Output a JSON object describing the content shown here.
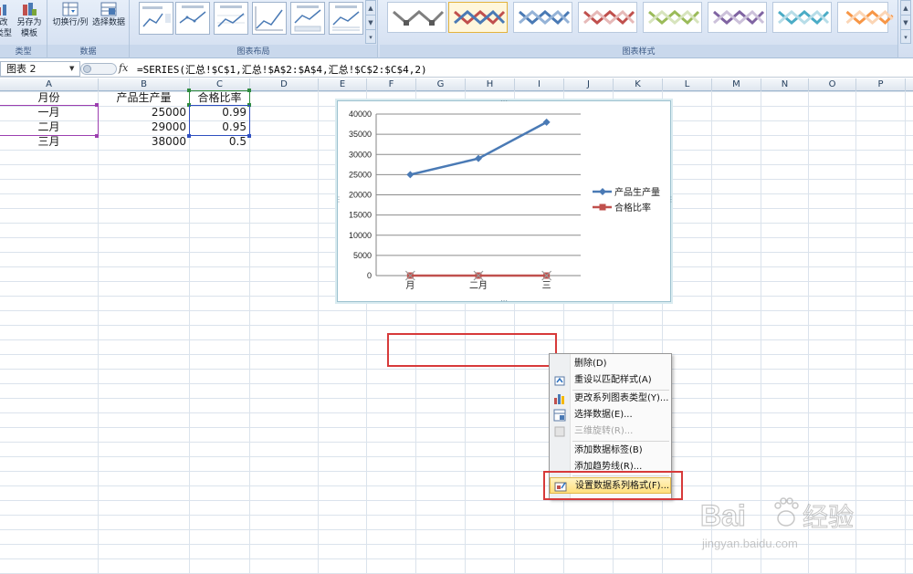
{
  "ribbon": {
    "type_group": {
      "btn_partial": "改",
      "btn_partial2": "类型",
      "save_template": "另存为",
      "save_template2": "模板",
      "label": "类型"
    },
    "data_group": {
      "switch_rowcol": "切换行/列",
      "select_data": "选择数据",
      "label": "数据"
    },
    "layout_group": {
      "label": "图表布局"
    },
    "style_group": {
      "label": "图表样式"
    }
  },
  "formula_bar": {
    "name_box": "图表 2",
    "fx": "fx",
    "formula": "=SERIES(汇总!$C$1,汇总!$A$2:$A$4,汇总!$C$2:$C$4,2)"
  },
  "columns": [
    "A",
    "B",
    "C",
    "D",
    "E",
    "F",
    "G",
    "H",
    "I",
    "J",
    "K",
    "L",
    "M",
    "N",
    "O",
    "P"
  ],
  "sheet": {
    "headers": [
      "月份",
      "产品生产量",
      "合格比率"
    ],
    "rows": [
      {
        "month": "一月",
        "output": "25000",
        "rate": "0.99"
      },
      {
        "month": "二月",
        "output": "29000",
        "rate": "0.95"
      },
      {
        "month": "三月",
        "output": "38000",
        "rate": "0.5"
      }
    ]
  },
  "colors": {
    "series1": "#4a7ab5",
    "series2": "#c0504d",
    "red_highlight": "#d73a3a"
  },
  "chart_data": {
    "type": "line",
    "categories": [
      "一月",
      "二月",
      "三月"
    ],
    "category_labels_visible": [
      "月",
      "二月",
      "三"
    ],
    "series": [
      {
        "name": "产品生产量",
        "values": [
          25000,
          29000,
          38000
        ]
      },
      {
        "name": "合格比率",
        "values": [
          0.99,
          0.95,
          0.5
        ]
      }
    ],
    "y_ticks": [
      "40000",
      "35000",
      "30000",
      "25000",
      "20000",
      "15000",
      "10000",
      "5000",
      "0"
    ],
    "ylim": [
      0,
      40000
    ],
    "grid": true,
    "legend": "right"
  },
  "context_menu": {
    "items": [
      {
        "label": "删除(D)",
        "icon": "none"
      },
      {
        "label": "重设以匹配样式(A)",
        "icon": "reset-style-icon"
      },
      {
        "label": "更改系列图表类型(Y)...",
        "icon": "bar-chart-icon"
      },
      {
        "label": "选择数据(E)...",
        "icon": "select-data-icon"
      },
      {
        "label": "三维旋转(R)...",
        "icon": "rotate-3d-icon"
      },
      {
        "label": "添加数据标签(B)",
        "icon": "none"
      },
      {
        "label": "添加趋势线(R)...",
        "icon": "none"
      },
      {
        "label": "设置数据系列格式(F)...",
        "icon": "format-series-icon"
      }
    ]
  },
  "watermark": {
    "brand": "Bai",
    "brand2": "经验",
    "url": "jingyan.baidu.com"
  }
}
